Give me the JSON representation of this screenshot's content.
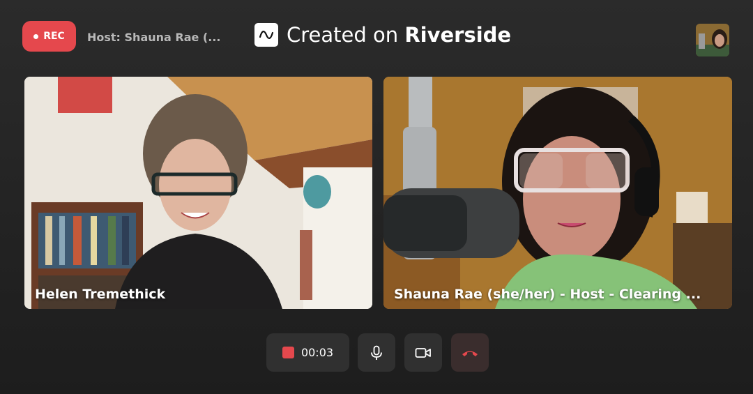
{
  "recording": {
    "label": "REC"
  },
  "host_label": "Host: Shauna Rae (...",
  "brand": {
    "prefix": "Created on",
    "name": "Riverside"
  },
  "participants": [
    {
      "name": "Helen Tremethick"
    },
    {
      "name": "Shauna Rae (she/her) - Host - Clearing ..."
    }
  ],
  "controls": {
    "timer": "00:03"
  },
  "colors": {
    "accent": "#e5484d",
    "background": "#262626",
    "control_bg": "#303030"
  }
}
